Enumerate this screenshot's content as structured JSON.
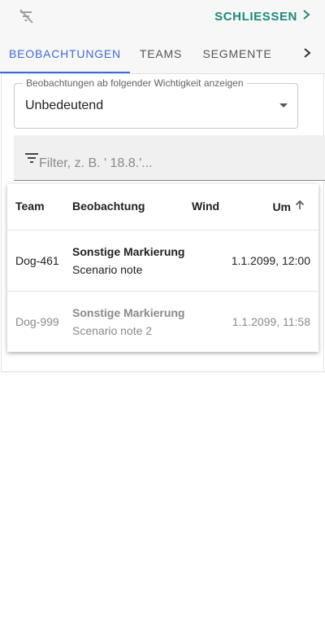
{
  "topbar": {
    "filter_icon": "filter-off-icon",
    "close_label": "SCHLIESSEN",
    "close_icon": "chevron-right-icon",
    "accent_color": "#1a8a7a"
  },
  "tabs": {
    "items": [
      {
        "label": "BEOBACHTUNGEN",
        "active": true
      },
      {
        "label": "TEAMS",
        "active": false
      },
      {
        "label": "SEGMENTE",
        "active": false
      }
    ],
    "scroll_icon": "chevron-right-icon",
    "active_color": "#3f6ad8"
  },
  "importance_select": {
    "label": "Beobachtungen ab folgender Wichtigkeit anzeigen",
    "value": "Unbedeutend"
  },
  "filter": {
    "placeholder": "Filter, z. B. ' 18.8.'...",
    "value": "",
    "icon": "filter-list-icon"
  },
  "table": {
    "columns": [
      "Team",
      "Beobachtung",
      "Wind",
      "Um"
    ],
    "sort": {
      "column": "Um",
      "direction": "asc",
      "icon": "arrow-up-icon"
    },
    "rows": [
      {
        "team": "Dog-461",
        "title": "Sonstige Markierung",
        "note": "Scenario note",
        "wind": "",
        "time": "1.1.2099, 12:00",
        "muted": false
      },
      {
        "team": "Dog-999",
        "title": "Sonstige Markierung",
        "note": "Scenario note 2",
        "wind": "",
        "time": "1.1.2099, 11:58",
        "muted": true
      }
    ]
  }
}
